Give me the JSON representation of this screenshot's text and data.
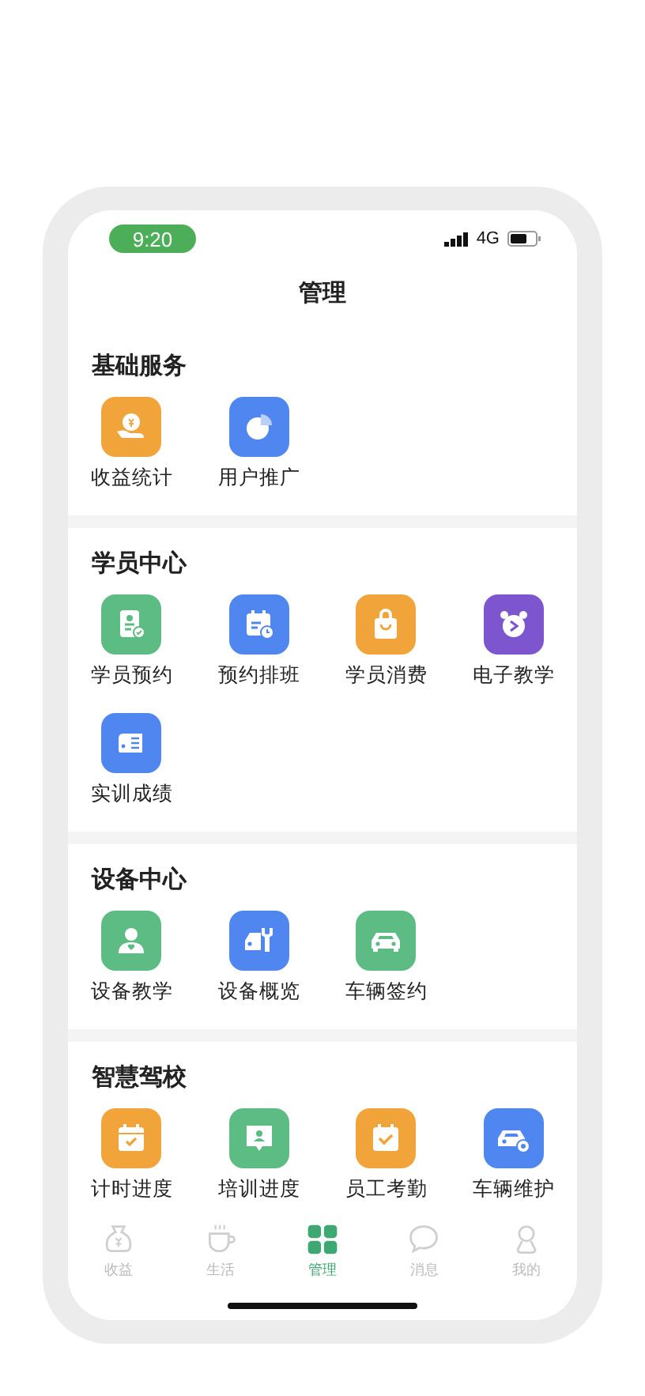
{
  "status_bar": {
    "time": "9:20",
    "network": "4G"
  },
  "title": "管理",
  "sections": [
    {
      "title": "基础服务",
      "items": [
        {
          "label": "收益统计",
          "color": "#f0a43a"
        },
        {
          "label": "用户推广",
          "color": "#4f86f0"
        }
      ]
    },
    {
      "title": "学员中心",
      "items": [
        {
          "label": "学员预约",
          "color": "#5dbb84"
        },
        {
          "label": "预约排班",
          "color": "#4f86f0"
        },
        {
          "label": "学员消费",
          "color": "#f0a43a"
        },
        {
          "label": "电子教学",
          "color": "#7d55cf"
        },
        {
          "label": "实训成绩",
          "color": "#4f86f0"
        }
      ]
    },
    {
      "title": "设备中心",
      "items": [
        {
          "label": "设备教学",
          "color": "#5dbb84"
        },
        {
          "label": "设备概览",
          "color": "#4f86f0"
        },
        {
          "label": "车辆签约",
          "color": "#5dbb84"
        }
      ]
    },
    {
      "title": "智慧驾校",
      "items": [
        {
          "label": "计时进度",
          "color": "#f0a43a"
        },
        {
          "label": "培训进度",
          "color": "#5dbb84"
        },
        {
          "label": "员工考勤",
          "color": "#f0a43a"
        },
        {
          "label": "车辆维护",
          "color": "#4f86f0"
        }
      ]
    }
  ],
  "tab_bar": [
    {
      "label": "收益",
      "selected": false
    },
    {
      "label": "生活",
      "selected": false
    },
    {
      "label": "管理",
      "selected": true
    },
    {
      "label": "消息",
      "selected": false
    },
    {
      "label": "我的",
      "selected": false
    }
  ]
}
